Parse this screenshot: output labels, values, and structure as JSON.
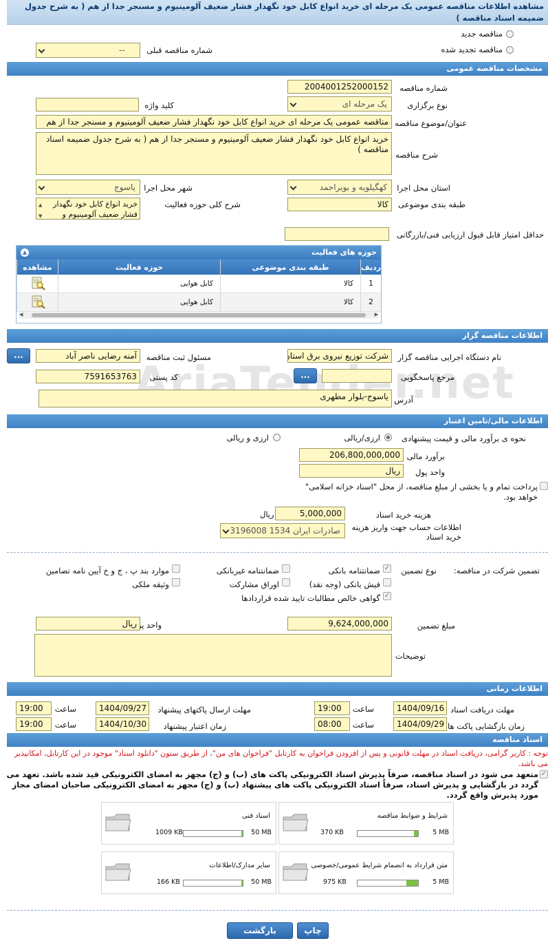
{
  "page_title": "مشاهده اطلاعات مناقصه عمومی یک مرحله ای خرید انواع کابل خود نگهدار فشار ضعیف آلومینیوم و مسنجر جدا از هم ( به شرح جدول ضمیمه اسناد مناقصه )",
  "top": {
    "new_tender": "مناقصه جدید",
    "renewed_tender": "مناقصه تجدید شده",
    "prev_tender_label": "شماره مناقصه قبلی",
    "prev_tender_value": "--"
  },
  "general": {
    "section_title": "مشخصات مناقصه عمومی",
    "number_label": "شماره مناقصه",
    "number_value": "2004001252000152",
    "type_label": "نوع برگزاری",
    "type_value": "یک مرحله ای",
    "keyword_label": "کلید واژه",
    "keyword_value": "",
    "subject_label": "عنوان/موضوع مناقصه",
    "subject_value": "مناقصه عمومی یک مرحله ای خرید انواع کابل خود نگهدار فشار ضعیف آلومینیوم و مسنجر جدا از هم",
    "desc_label": "شرح مناقصه",
    "desc_value": "خرید انواع کابل خود نگهدار فشار ضعیف آلومینیوم و مسنجر جدا از هم  ( به شرح جدول ضمیمه اسناد مناقصه )",
    "province_label": "استان محل اجرا",
    "province_value": "کهگیلویه و بویراحمد",
    "city_label": "شهر محل اجرا",
    "city_value": "یاسوج",
    "category_label": "طبقه بندی موضوعی",
    "category_value": "کالا",
    "activity_label": "شرح کلی حوزه فعالیت",
    "activity_value": "خرید انواع کابل خود نگهدار فشار ضعیف آلومینیوم و",
    "min_score_label": "حداقل امتیاز قابل قبول ارزیابی فنی/بازرگانی",
    "min_score_value": ""
  },
  "activity_grid": {
    "title": "حوزه های فعالیت",
    "headers": {
      "row": "ردیف",
      "category": "طبقه بندی موضوعی",
      "field": "حوزه فعالیت",
      "view": "مشاهده"
    },
    "rows": [
      {
        "row": "1",
        "category": "کالا",
        "field": "کابل هوایی"
      },
      {
        "row": "2",
        "category": "کالا",
        "field": "کابل هوایی"
      }
    ]
  },
  "organizer": {
    "section_title": "اطلاعات مناقصه گزار",
    "org_label": "نام دستگاه اجرایی مناقصه گزار",
    "org_value": "شرکت توزیع نیروی برق استان کهگیلویه و بویراحمد",
    "registrar_label": "مسئول ثبت مناقصه",
    "registrar_value": "آمنه رضایی ناصر آباد",
    "dots": "...",
    "reference_label": "مرجع پاسخگویی",
    "reference_value": "",
    "postal_label": "کد پستی",
    "postal_value": "7591653763",
    "address_label": "آدرس",
    "address_value": "یاسوج-بلوار مطهری"
  },
  "finance": {
    "section_title": "اطلاعات مالی/تامین اعتبار",
    "estimate_type_label": "نحوه ی برآورد مالی و قیمت پیشنهادی",
    "opt_currency_rial": "ارزی/ریالی",
    "opt_currency_and_rial": "ارزی و ریالی",
    "estimate_label": "برآورد مالی",
    "estimate_value": "206,800,000,000",
    "currency_label": "واحد پول",
    "currency_value": "ریال",
    "treasury_text": "پرداخت تمام و یا بخشی از مبلغ مناقصه، از محل \"اسناد خزانه اسلامی\" خواهد بود.",
    "doc_fee_label": "هزینه خرید اسناد",
    "doc_fee_value": "5,000,000",
    "doc_fee_unit": "ریال",
    "account_label": "اطلاعات حساب جهت واریز هزینه خرید اسناد",
    "account_value": "صادرات ایران 1534 3196008"
  },
  "guarantee": {
    "title_label": "تضمین شرکت در مناقصه:",
    "type_label": "نوع تضمین",
    "items": {
      "bank_guarantee": "ضمانتنامه بانکی",
      "non_bank_guarantee": "ضمانتنامه غیربانکی",
      "bylaw_items": "موارد بند پ ، ج و خ آیین نامه تضامین",
      "bank_receipt": "فیش بانکی (وجه نقد)",
      "participation_bonds": "اوراق مشارکت",
      "property_collateral": "وثیقه ملکی",
      "net_claims": "گواهی خالص مطالبات تایید شده قراردادها"
    },
    "amount_label": "مبلغ تضمین",
    "amount_value": "9,624,000,000",
    "currency_label": "واحد پول",
    "currency_value": "ریال",
    "notes_label": "توضیحات",
    "notes_value": ""
  },
  "timing": {
    "section_title": "اطلاعات زمانی",
    "doc_receive_label": "مهلت دریافت اسناد",
    "doc_receive_date": "1404/09/16",
    "doc_receive_time": "19:00",
    "submit_label": "مهلت ارسال پاکتهای پیشنهاد",
    "submit_date": "1404/09/27",
    "submit_time": "19:00",
    "opening_label": "زمان بازگشایی پاکت ها",
    "opening_date": "1404/09/29",
    "opening_time": "08:00",
    "validity_label": "زمان اعتبار پیشنهاد",
    "validity_date": "1404/10/30",
    "validity_time": "19:00",
    "time_label": "ساعت"
  },
  "documents": {
    "section_title": "اسناد مناقصه",
    "notice_red": "توجه : کاربر گرامی، دریافت اسناد در مهلت قانونی و پس از افزودن فراخوان به کارتابل \"فراخوان های من\"، از طریق ستون \"دانلود اسناد\" موجود در این کارتابل، امکانپذیر می باشد.",
    "commitment": "متعهد می شود در اسناد مناقصه، صرفاً پذیرش اسناد الکترونیکی پاکت های (ب) و (ج) مجهز به امضای الکترونیکی قید شده باشد. تعهد می گردد در بازگشایی و پذیرش اسناد، صرفاً اسناد الکترونیکی پاکت های پیشنهاد (ب) و (ج) مجهز به امضای الکترونیکی صاحبان امضای مجاز مورد پذیرش واقع گردد.",
    "files": [
      {
        "name": "شرایط و ضوابط مناقصه",
        "size": "370 KB",
        "max": "5 MB",
        "fill": 0.07
      },
      {
        "name": "اسناد فنی",
        "size": "1009 KB",
        "max": "50 MB",
        "fill": 0.02
      },
      {
        "name": "متن قرارداد به انضمام شرایط عمومی/خصوصی",
        "size": "975 KB",
        "max": "5 MB",
        "fill": 0.19
      },
      {
        "name": "سایر مدارک/اطلاعات",
        "size": "166 KB",
        "max": "50 MB",
        "fill": 0.01
      }
    ]
  },
  "actions": {
    "print": "چاپ",
    "back": "بازگشت"
  },
  "watermark": "AriaTender.net",
  "colors": {
    "section": "#3f82c4",
    "field_bg": "#fff8c4",
    "red": "#d8141b",
    "progress": "#7cc242"
  }
}
